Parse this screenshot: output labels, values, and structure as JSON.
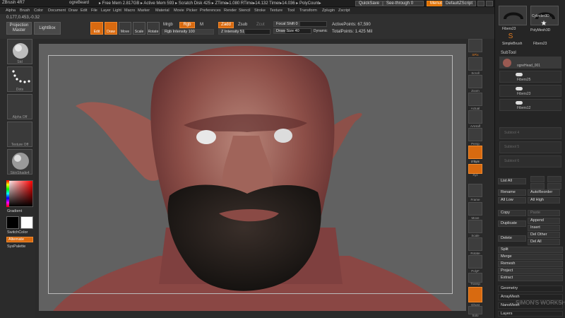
{
  "titlebar": {
    "app": "ZBrush 4R7",
    "doc": "ogreBeard",
    "stats": "▸ Free Mem 2.817GB ▸ Active Mem 593 ▸ Scratch Disk 425 ▸ ZTime▸1.080 RTime▸14.132 Timer▸14.036 ▸ PolyCount▸",
    "quicksave": "QuickSave",
    "see_through": "See-through  0",
    "menus": "Menus",
    "default_script": "DefaultZScript"
  },
  "menubar": [
    "Alpha",
    "Brush",
    "Color",
    "Document",
    "Draw",
    "Edit",
    "File",
    "Layer",
    "Light",
    "Macro",
    "Marker",
    "Material",
    "Movie",
    "Picker",
    "Preferences",
    "Render",
    "Stencil",
    "Stroke",
    "Texture",
    "Tool",
    "Transform",
    "Zplugin",
    "Zscript"
  ],
  "coords": "0.177,0.453,-0.32",
  "shelf": {
    "projection_master": "Projection Master",
    "lightbox": "LightBox",
    "edit": "Edit",
    "draw": "Draw",
    "move": "Move",
    "scale": "Scale",
    "rotate": "Rotate",
    "mrgb": "Mrgb",
    "rgb": "Rgb",
    "m": "M",
    "rgb_intensity": "Rgb Intensity 100",
    "zadd": "Zadd",
    "zsub": "Zsub",
    "zcut": "Zcut",
    "z_intensity": "Z Intensity 51",
    "focal_shift": "Focal Shift 0",
    "draw_size": "Draw Size 40",
    "dynamic": "Dynamic",
    "active_points": "ActivePoints: 67,590",
    "total_points": "TotalPoints: 1.425 Mil"
  },
  "left": {
    "brush_lbl": "Std",
    "stroke_lbl": "Dots",
    "alpha_lbl": "Alpha Off",
    "texture_lbl": "Texture Off",
    "material_lbl": "SkinShade4",
    "gradient": "Gradient",
    "switch_color": "SwitchColor",
    "alternate": "Alternate",
    "sys_palette": "SysPalette"
  },
  "righttools": [
    "SPix",
    "Scroll",
    "Zoom",
    "Actual",
    "AAHalf",
    "Persp",
    "Floor",
    "L.Sym",
    "Xyz",
    "Frame",
    "Move",
    "Scale",
    "Rotate",
    "PolyF",
    "Transp",
    "Ghost",
    "Solo"
  ],
  "tray": {
    "tools_top": [
      "Fibers23",
      "Cylinder3D",
      "PolyMesh3D",
      "SimpleBrush",
      "Fibers23"
    ],
    "subtool_title": "SubTool",
    "subtools": [
      "ogreHead_001",
      "Fibers25",
      "Fibers23",
      "Fibers12"
    ],
    "empty_slots": [
      "Subtool 4",
      "Subtool 5",
      "Subtool 6"
    ],
    "list_all": "List All",
    "rename": "Rename",
    "auto_reorder": "AutoReorder",
    "all_low": "All Low",
    "all_high": "All High",
    "copy": "Copy",
    "paste": "Paste",
    "duplicate": "Duplicate",
    "append": "Append",
    "insert": "Insert",
    "delete": "Delete",
    "del_other": "Del Other",
    "del_all": "Del All",
    "split": "Split",
    "merge": "Merge",
    "remesh": "Remesh",
    "project": "Project",
    "extract": "Extract",
    "geometry": "Geometry",
    "array_mesh": "ArrayMesh",
    "nano_mesh": "NanoMesh",
    "layers": "Layers"
  },
  "watermark": "SIMON'S WORKSHOP",
  "colors": {
    "accent": "#d86a10",
    "bg": "#2a2a2a",
    "canvas": "#616161"
  }
}
